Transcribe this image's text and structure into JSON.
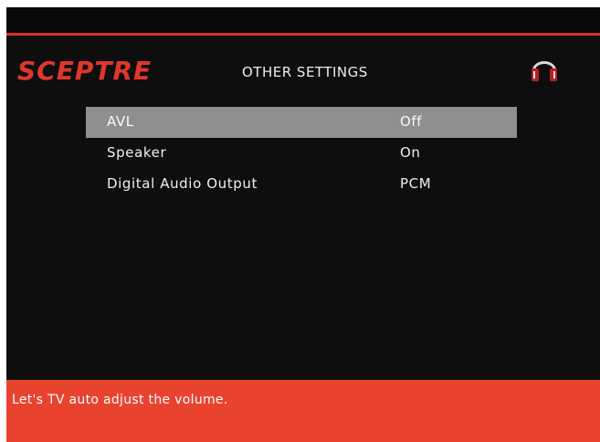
{
  "brand": {
    "name": "SCEPTRE",
    "color": "#e0362c"
  },
  "header": {
    "title": "OTHER SETTINGS",
    "icon": "headphones-icon"
  },
  "menu": {
    "items": [
      {
        "label": "AVL",
        "value": "Off",
        "selected": true
      },
      {
        "label": "Speaker",
        "value": "On",
        "selected": false
      },
      {
        "label": "Digital Audio Output",
        "value": "PCM",
        "selected": false
      }
    ]
  },
  "help": {
    "text": "Let's TV auto adjust the volume."
  },
  "colors": {
    "background": "#0e0e0e",
    "accent": "#e8432f",
    "highlight": "#8f8f8f"
  }
}
